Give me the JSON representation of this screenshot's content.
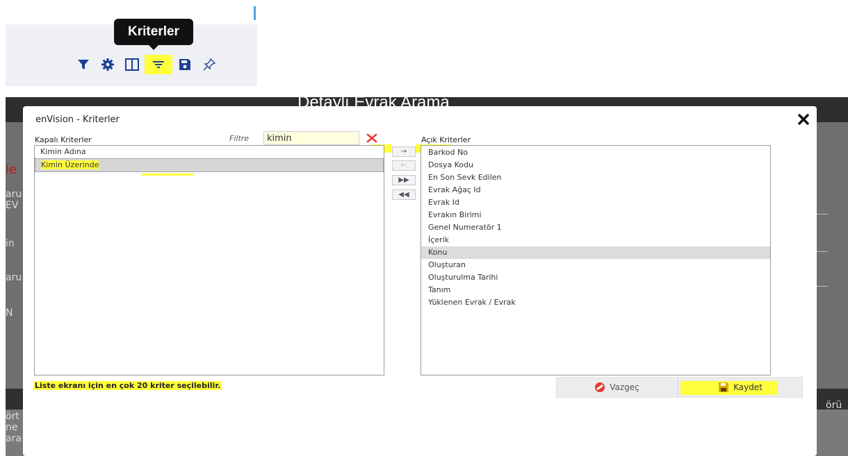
{
  "toolbar": {
    "tooltip": "Kriterler",
    "icons": [
      "filter-icon",
      "gear-icon",
      "columns-icon",
      "criteria-icon",
      "save-icon",
      "pin-icon"
    ]
  },
  "background": {
    "page_title": "Detaylı Evrak Arama",
    "fragments": [
      "le",
      "aru",
      "EV",
      "in",
      "aru",
      "N",
      "ört",
      "ne",
      "ara",
      "örü"
    ]
  },
  "dialog": {
    "title": "enVision - Kriterler",
    "closed_label": "Kapalı Kriterler",
    "open_label": "Açık Kriterler",
    "filter_label": "Filtre",
    "filter_value": "kimin",
    "closed_items": [
      "Kimin Adına",
      "Kimin Üzerinde"
    ],
    "open_items": [
      "Barkod No",
      "Dosya Kodu",
      "En Son Sevk Edilen",
      "Evrak Ağaç Id",
      "Evrak Id",
      "Evrakın Birimi",
      "Genel Numeratör 1",
      "İçerik",
      "Konu",
      "Oluşturan",
      "Oluşturulma Tarihi",
      "Tanım",
      "Yüklenen Evrak / Evrak"
    ],
    "move_buttons": [
      "→",
      "←",
      "▶▶",
      "◀◀"
    ],
    "note": "Liste ekranı için en çok 20 kriter seçilebilir.",
    "cancel_label": "Vazgeç",
    "save_label": "Kaydet",
    "colors": {
      "highlight": "#ffff3c",
      "cancel_icon": "#e53935",
      "save_icon": "#e0a800"
    }
  }
}
